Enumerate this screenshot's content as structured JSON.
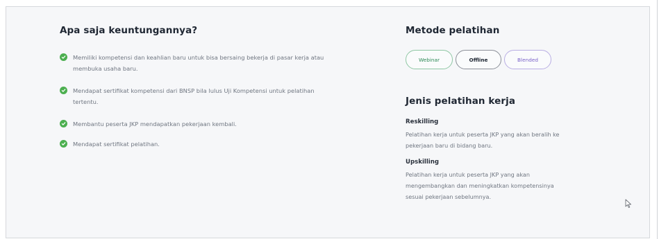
{
  "benefits": {
    "title": "Apa saja keuntungannya?",
    "items": [
      "Memiliki kompetensi dan keahlian baru untuk bisa bersaing bekerja di pasar kerja atau membuka usaha baru.",
      "Mendapat sertifikat kompetensi dari BNSP bila lulus Uji Kompetensi untuk pelatihan tertentu.",
      "Membantu peserta JKP mendapatkan pekerjaan kembali.",
      "Mendapat sertifikat pelatihan."
    ]
  },
  "methods": {
    "title": "Metode pelatihan",
    "options": [
      "Webinar",
      "Offline",
      "Blended"
    ]
  },
  "jenis": {
    "title": "Jenis pelatihan kerja",
    "types": [
      {
        "label": "Reskilling",
        "desc_lines": [
          "Pelatihan kerja untuk peserta JKP yang akan beralih ke",
          "pekerjaan baru di bidang baru."
        ]
      },
      {
        "label": "Upskilling",
        "desc_lines": [
          "Pelatihan kerja untuk peserta JKP yang akan",
          "mengembangkan dan meningkatkan kompetensinya",
          "sesuai pekerjaan sebelumnya."
        ]
      }
    ]
  },
  "colors": {
    "check": "#4caf50",
    "heading": "#1f2733",
    "body_text": "#6f7681"
  }
}
